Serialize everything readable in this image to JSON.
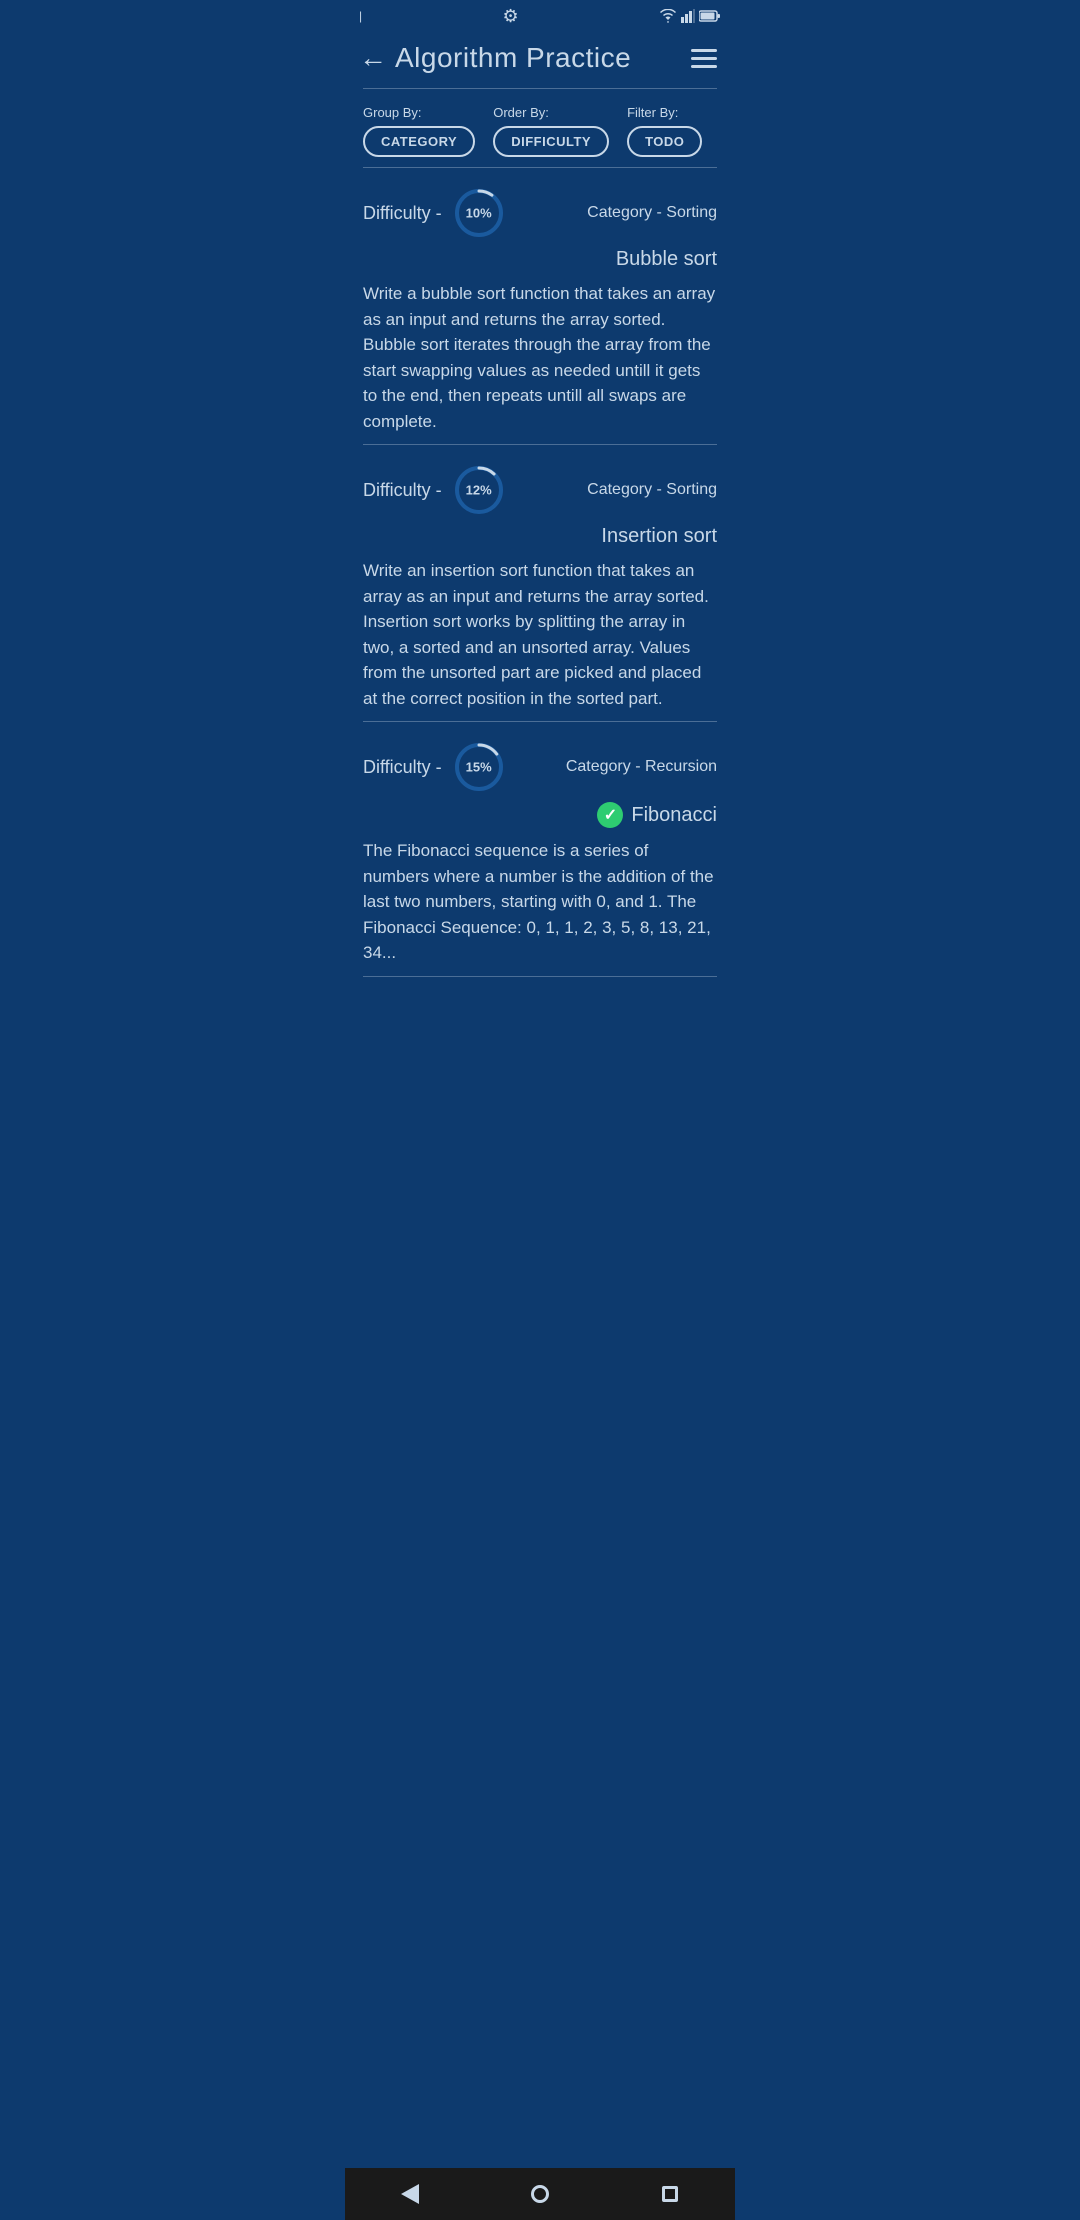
{
  "statusBar": {
    "time": "|",
    "gearIcon": "⚙"
  },
  "header": {
    "backLabel": "←",
    "title": "Algorithm Practice",
    "menuIcon": "menu"
  },
  "filters": {
    "groupByLabel": "Group By:",
    "groupByValue": "CATEGORY",
    "orderByLabel": "Order By:",
    "orderByValue": "DIFFICULTY",
    "filterByLabel": "Filter By:",
    "filterByValue": "TODO"
  },
  "cards": [
    {
      "difficultyLabel": "Difficulty -",
      "progress": 10,
      "progressText": "10%",
      "categoryLabel": "Category - Sorting",
      "title": "Bubble sort",
      "completed": false,
      "description": "Write a bubble sort function that takes an array as an input and returns the array sorted. Bubble sort iterates through the array from the start swapping values as needed untill it gets to the end, then repeats untill all swaps are complete."
    },
    {
      "difficultyLabel": "Difficulty -",
      "progress": 12,
      "progressText": "12%",
      "categoryLabel": "Category - Sorting",
      "title": "Insertion sort",
      "completed": false,
      "description": "Write an insertion sort function that takes an array as an input and returns the array sorted. Insertion sort works by splitting the array in two, a sorted and an unsorted array. Values from the unsorted part are picked and placed at the correct position in the sorted part."
    },
    {
      "difficultyLabel": "Difficulty -",
      "progress": 15,
      "progressText": "15%",
      "categoryLabel": "Category - Recursion",
      "title": "Fibonacci",
      "completed": true,
      "description": "The Fibonacci sequence is a series of numbers where a number is the addition of the last two numbers, starting with 0, and 1.\nThe Fibonacci Sequence: 0, 1, 1, 2, 3, 5, 8, 13, 21, 34..."
    }
  ],
  "navBar": {
    "backBtn": "back",
    "homeBtn": "home",
    "recentBtn": "recent"
  }
}
